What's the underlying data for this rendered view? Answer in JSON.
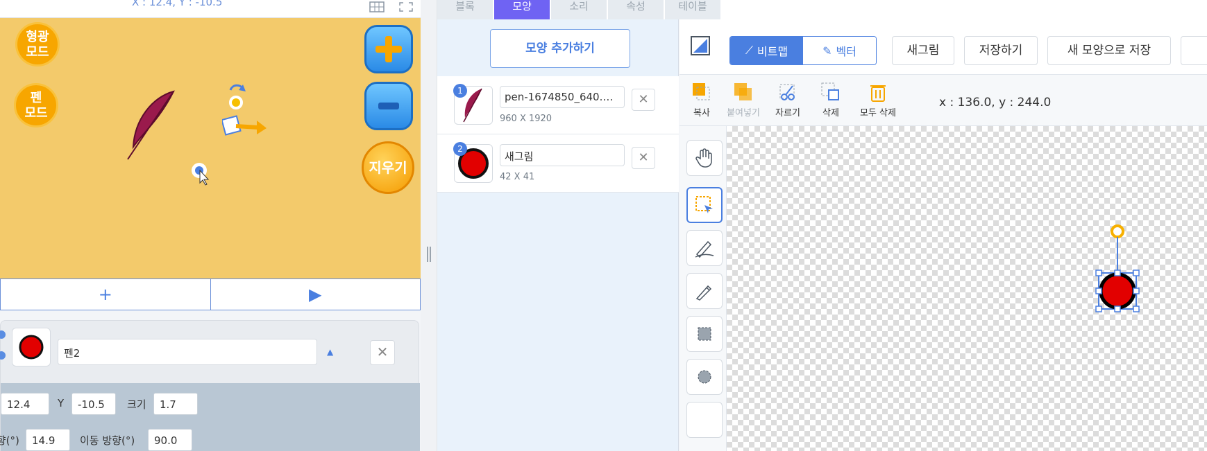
{
  "stage": {
    "coord_text": "X : 12.4, Y : -10.5",
    "effect_mode_label": "형광\n모드",
    "pen_mode_label": "펜\n모드",
    "erase_label": "지우기",
    "add_symbol": "+",
    "play_symbol": "▶"
  },
  "sprite": {
    "name": "펜2",
    "x_value": "12.4",
    "y_label": "Y",
    "y_value": "-10.5",
    "size_label": "크기",
    "size_value": "1.7",
    "direction_label": "방향(°)",
    "direction_value": "14.9",
    "move_direction_label": "이동 방향(°)",
    "move_direction_value": "90.0"
  },
  "tabs": [
    "블록",
    "모양",
    "소리",
    "속성",
    "테이블"
  ],
  "active_tab_index": 1,
  "shapes": {
    "add_label": "모양 추가하기",
    "items": [
      {
        "num": "1",
        "name": "pen-1674850_640.…",
        "dims": "960 X 1920"
      },
      {
        "num": "2",
        "name": "새그림",
        "dims": "42 X 41"
      }
    ]
  },
  "editor": {
    "bitmap_label": "비트맵",
    "vector_label": "벡터",
    "new_label": "새그림",
    "save_label": "저장하기",
    "save_new_label": "새 모양으로 저장",
    "copy_label": "복사",
    "paste_label": "붙여넣기",
    "cut_label": "자르기",
    "delete_label": "삭제",
    "delete_all_label": "모두 삭제",
    "coord_readout": "x : 136.0, y : 244.0"
  },
  "colors": {
    "accent": "#4a7fe0",
    "active_tab": "#6f63f3",
    "stage_bg": "#f3ca6b",
    "object_red": "#e20000"
  }
}
